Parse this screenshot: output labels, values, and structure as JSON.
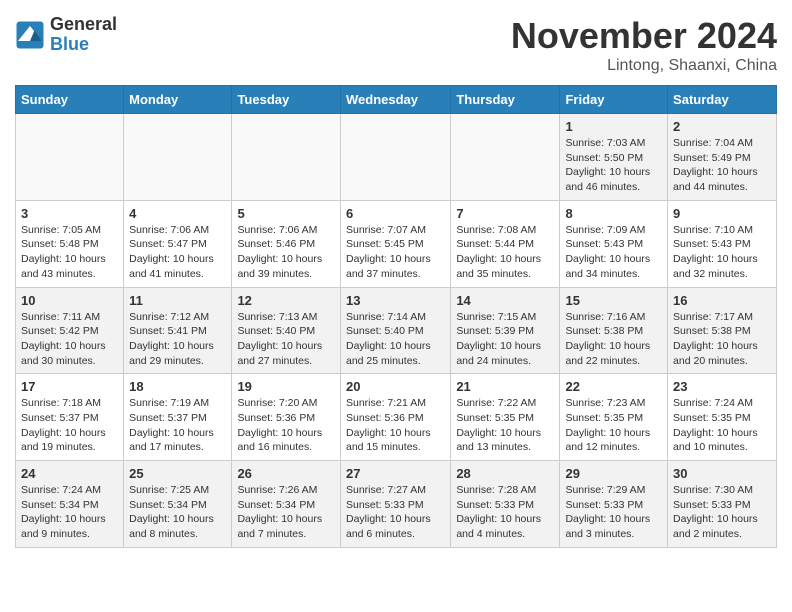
{
  "header": {
    "logo_general": "General",
    "logo_blue": "Blue",
    "month_title": "November 2024",
    "location": "Lintong, Shaanxi, China"
  },
  "weekdays": [
    "Sunday",
    "Monday",
    "Tuesday",
    "Wednesday",
    "Thursday",
    "Friday",
    "Saturday"
  ],
  "weeks": [
    [
      {
        "day": "",
        "info": ""
      },
      {
        "day": "",
        "info": ""
      },
      {
        "day": "",
        "info": ""
      },
      {
        "day": "",
        "info": ""
      },
      {
        "day": "",
        "info": ""
      },
      {
        "day": "1",
        "info": "Sunrise: 7:03 AM\nSunset: 5:50 PM\nDaylight: 10 hours and 46 minutes."
      },
      {
        "day": "2",
        "info": "Sunrise: 7:04 AM\nSunset: 5:49 PM\nDaylight: 10 hours and 44 minutes."
      }
    ],
    [
      {
        "day": "3",
        "info": "Sunrise: 7:05 AM\nSunset: 5:48 PM\nDaylight: 10 hours and 43 minutes."
      },
      {
        "day": "4",
        "info": "Sunrise: 7:06 AM\nSunset: 5:47 PM\nDaylight: 10 hours and 41 minutes."
      },
      {
        "day": "5",
        "info": "Sunrise: 7:06 AM\nSunset: 5:46 PM\nDaylight: 10 hours and 39 minutes."
      },
      {
        "day": "6",
        "info": "Sunrise: 7:07 AM\nSunset: 5:45 PM\nDaylight: 10 hours and 37 minutes."
      },
      {
        "day": "7",
        "info": "Sunrise: 7:08 AM\nSunset: 5:44 PM\nDaylight: 10 hours and 35 minutes."
      },
      {
        "day": "8",
        "info": "Sunrise: 7:09 AM\nSunset: 5:43 PM\nDaylight: 10 hours and 34 minutes."
      },
      {
        "day": "9",
        "info": "Sunrise: 7:10 AM\nSunset: 5:43 PM\nDaylight: 10 hours and 32 minutes."
      }
    ],
    [
      {
        "day": "10",
        "info": "Sunrise: 7:11 AM\nSunset: 5:42 PM\nDaylight: 10 hours and 30 minutes."
      },
      {
        "day": "11",
        "info": "Sunrise: 7:12 AM\nSunset: 5:41 PM\nDaylight: 10 hours and 29 minutes."
      },
      {
        "day": "12",
        "info": "Sunrise: 7:13 AM\nSunset: 5:40 PM\nDaylight: 10 hours and 27 minutes."
      },
      {
        "day": "13",
        "info": "Sunrise: 7:14 AM\nSunset: 5:40 PM\nDaylight: 10 hours and 25 minutes."
      },
      {
        "day": "14",
        "info": "Sunrise: 7:15 AM\nSunset: 5:39 PM\nDaylight: 10 hours and 24 minutes."
      },
      {
        "day": "15",
        "info": "Sunrise: 7:16 AM\nSunset: 5:38 PM\nDaylight: 10 hours and 22 minutes."
      },
      {
        "day": "16",
        "info": "Sunrise: 7:17 AM\nSunset: 5:38 PM\nDaylight: 10 hours and 20 minutes."
      }
    ],
    [
      {
        "day": "17",
        "info": "Sunrise: 7:18 AM\nSunset: 5:37 PM\nDaylight: 10 hours and 19 minutes."
      },
      {
        "day": "18",
        "info": "Sunrise: 7:19 AM\nSunset: 5:37 PM\nDaylight: 10 hours and 17 minutes."
      },
      {
        "day": "19",
        "info": "Sunrise: 7:20 AM\nSunset: 5:36 PM\nDaylight: 10 hours and 16 minutes."
      },
      {
        "day": "20",
        "info": "Sunrise: 7:21 AM\nSunset: 5:36 PM\nDaylight: 10 hours and 15 minutes."
      },
      {
        "day": "21",
        "info": "Sunrise: 7:22 AM\nSunset: 5:35 PM\nDaylight: 10 hours and 13 minutes."
      },
      {
        "day": "22",
        "info": "Sunrise: 7:23 AM\nSunset: 5:35 PM\nDaylight: 10 hours and 12 minutes."
      },
      {
        "day": "23",
        "info": "Sunrise: 7:24 AM\nSunset: 5:35 PM\nDaylight: 10 hours and 10 minutes."
      }
    ],
    [
      {
        "day": "24",
        "info": "Sunrise: 7:24 AM\nSunset: 5:34 PM\nDaylight: 10 hours and 9 minutes."
      },
      {
        "day": "25",
        "info": "Sunrise: 7:25 AM\nSunset: 5:34 PM\nDaylight: 10 hours and 8 minutes."
      },
      {
        "day": "26",
        "info": "Sunrise: 7:26 AM\nSunset: 5:34 PM\nDaylight: 10 hours and 7 minutes."
      },
      {
        "day": "27",
        "info": "Sunrise: 7:27 AM\nSunset: 5:33 PM\nDaylight: 10 hours and 6 minutes."
      },
      {
        "day": "28",
        "info": "Sunrise: 7:28 AM\nSunset: 5:33 PM\nDaylight: 10 hours and 4 minutes."
      },
      {
        "day": "29",
        "info": "Sunrise: 7:29 AM\nSunset: 5:33 PM\nDaylight: 10 hours and 3 minutes."
      },
      {
        "day": "30",
        "info": "Sunrise: 7:30 AM\nSunset: 5:33 PM\nDaylight: 10 hours and 2 minutes."
      }
    ]
  ]
}
